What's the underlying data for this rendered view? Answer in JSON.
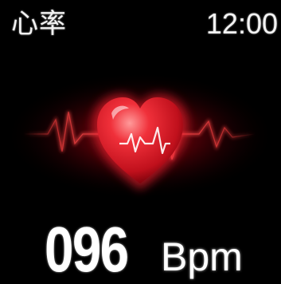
{
  "status_bar": {
    "title": "心率",
    "time": "12:00"
  },
  "heart_rate": {
    "value": "096",
    "unit": "Bpm"
  },
  "colors": {
    "background": "#000000",
    "accent": "#e0202a",
    "text": "#ffffff"
  },
  "icons": {
    "heart": "heart-icon",
    "pulse": "pulse-line"
  }
}
